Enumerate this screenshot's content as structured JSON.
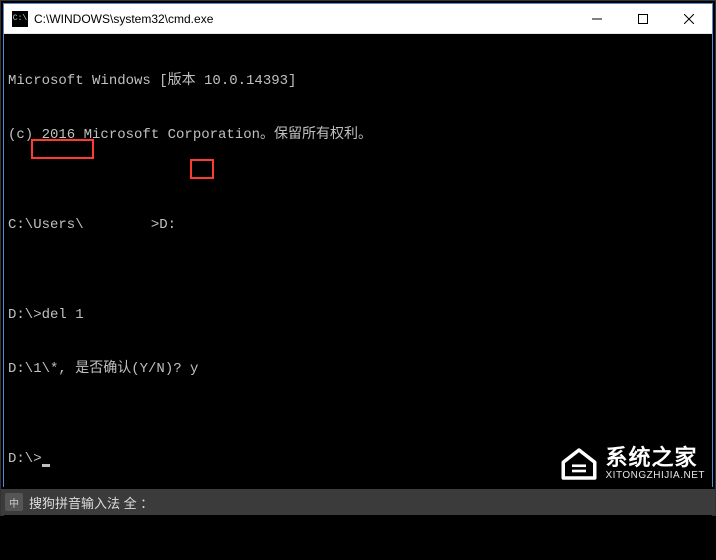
{
  "window": {
    "title": "C:\\WINDOWS\\system32\\cmd.exe",
    "icon_glyph": "C:\\"
  },
  "terminal": {
    "lines": [
      "Microsoft Windows [版本 10.0.14393]",
      "(c) 2016 Microsoft Corporation。保留所有权利。",
      "",
      "C:\\Users\\        >D:",
      "",
      "D:\\>del 1",
      "D:\\1\\*, 是否确认(Y/N)? y",
      "",
      "D:\\>"
    ]
  },
  "highlights": [
    {
      "text": "del 1"
    },
    {
      "text": "y"
    }
  ],
  "ime": {
    "label": "搜狗拼音输入法 全 ："
  },
  "watermark": {
    "main": "系统之家",
    "sub": "XITONGZHIJIA.NET"
  }
}
